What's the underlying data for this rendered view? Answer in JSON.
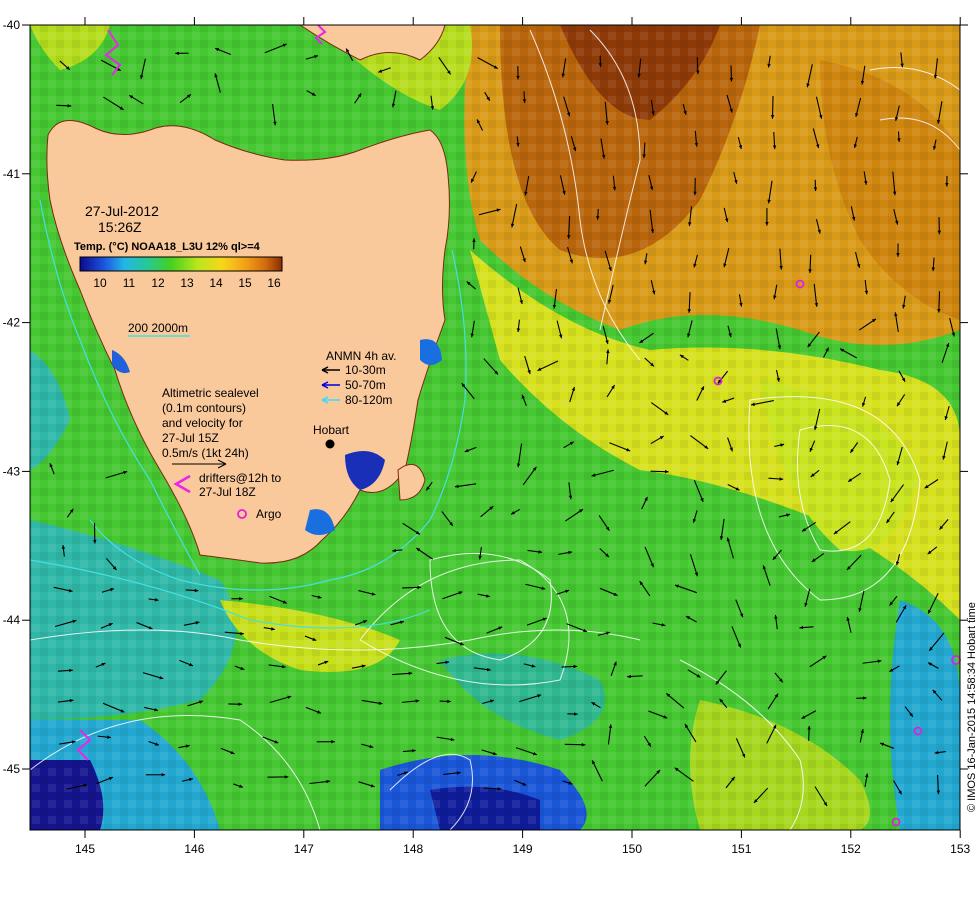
{
  "map": {
    "date": "27-Jul-2012",
    "time": "15:26Z",
    "product": "Temp. (°C) NOAA18_L3U 12% ql>=4",
    "colorbar_ticks": [
      "10",
      "11",
      "12",
      "13",
      "14",
      "15",
      "16"
    ],
    "colorbar_colors": [
      "#0a0a8a",
      "#1d55e0",
      "#22b7e6",
      "#27c98f",
      "#45d11f",
      "#b8e61c",
      "#f7d81a",
      "#f4a016",
      "#cf6a0e",
      "#8a2e06"
    ],
    "isobath_label": "200  2000m",
    "isobath_colors": {
      "200m": "#44e0e0",
      "2000m": "#ffffff"
    },
    "anmn_title": "ANMN 4h av.",
    "anmn_items": [
      {
        "label": "10-30m",
        "color": "#000000"
      },
      {
        "label": "50-70m",
        "color": "#0000dd"
      },
      {
        "label": "80-120m",
        "color": "#33ddff"
      }
    ],
    "altimetry_lines": [
      "Altimetric sealevel",
      "(0.1m contours)",
      "and velocity for",
      "27-Jul 15Z",
      "0.5m/s (1kt 24h)"
    ],
    "drifters_lines": [
      "drifters@12h to",
      "27-Jul 18Z"
    ],
    "argo_label": "Argo",
    "city_label": "Hobart",
    "credit": "© IMOS 16-Jan-2015 14:58:34 Hobart time",
    "x_ticks": [
      "145",
      "146",
      "147",
      "148",
      "149",
      "150",
      "151",
      "152",
      "153"
    ],
    "y_ticks": [
      "-40",
      "-41",
      "-42",
      "-43",
      "-44",
      "-45"
    ],
    "land_color": "#f9c89b",
    "argo_color": "#dd22dd",
    "drifter_color": "#ee22ee"
  }
}
